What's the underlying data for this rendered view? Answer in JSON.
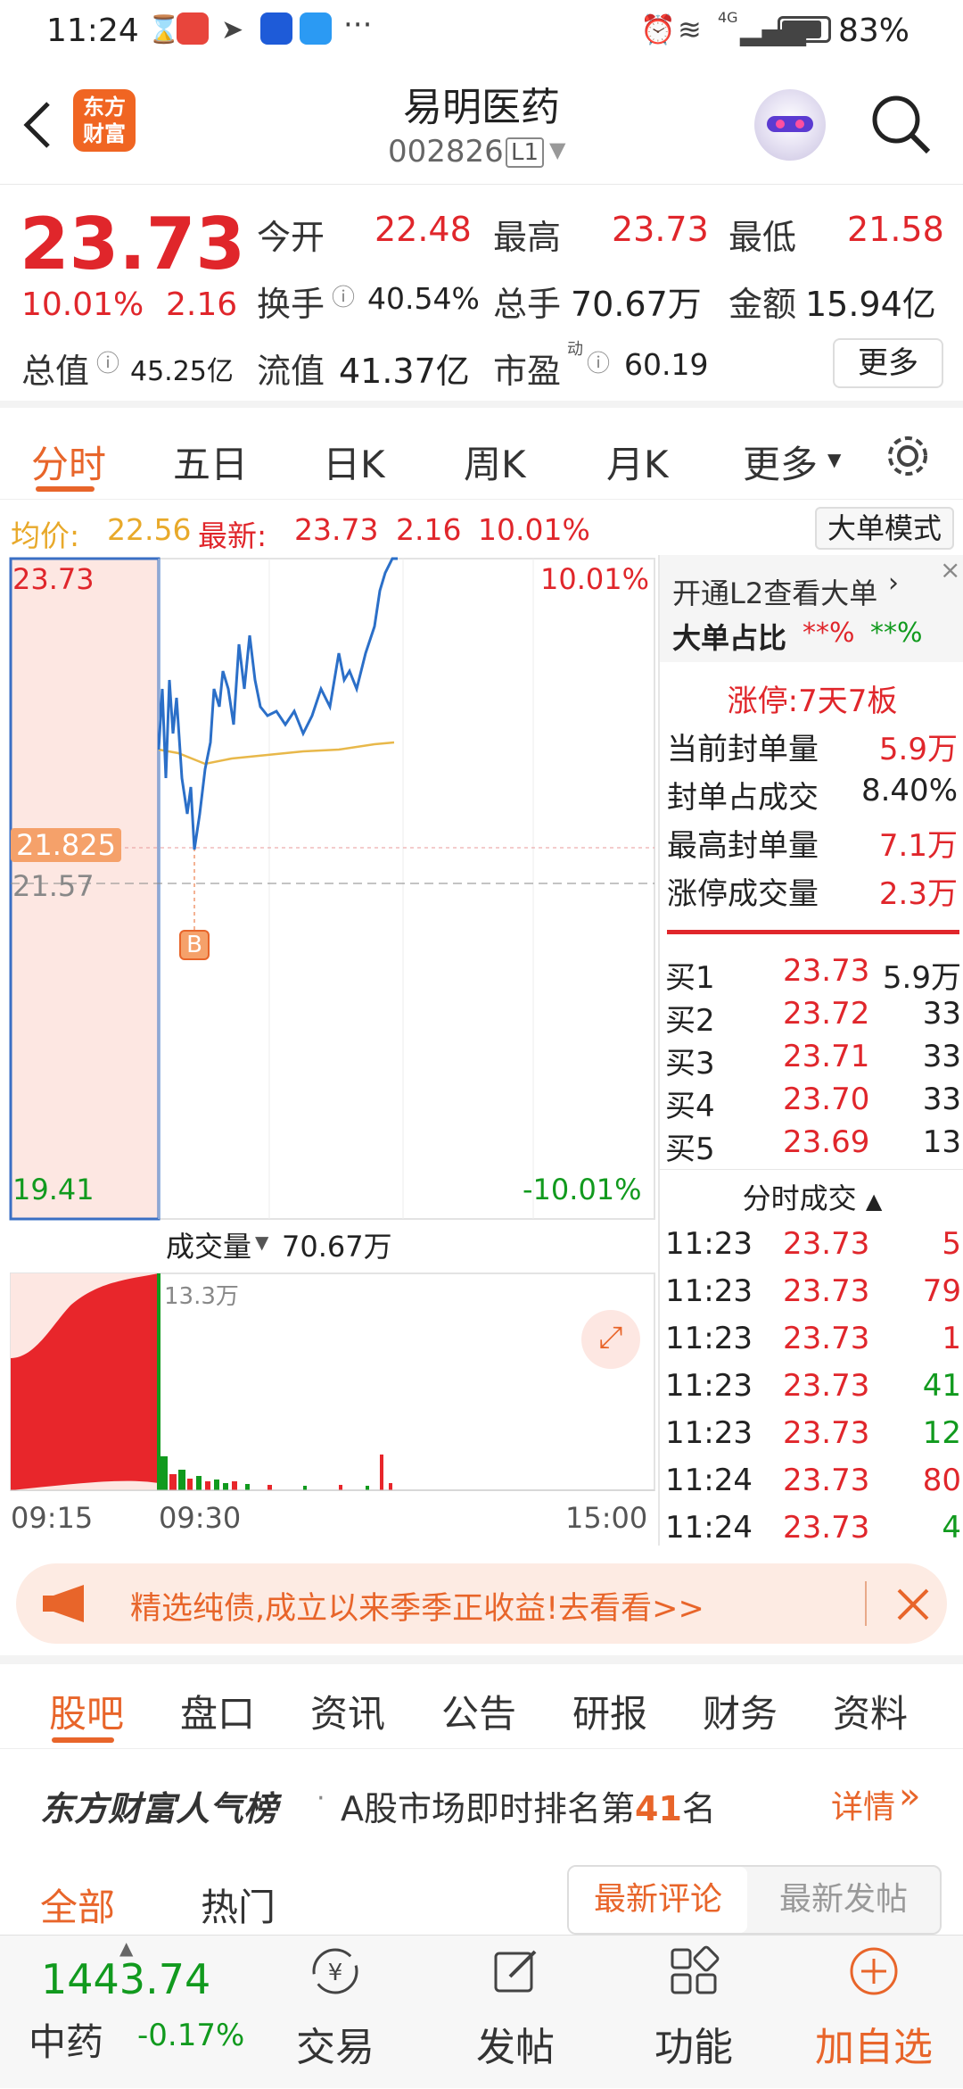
{
  "status": {
    "time": "11:24",
    "battery": "83%",
    "network": "4G"
  },
  "header": {
    "title": "易明医药",
    "code": "002826",
    "badge": "L1",
    "logo_text": "东方\n财富"
  },
  "quote": {
    "price": "23.73",
    "change_pct": "10.01%",
    "change_amt": "2.16",
    "open_label": "今开",
    "open": "22.48",
    "high_label": "最高",
    "high": "23.73",
    "low_label": "最低",
    "low": "21.58",
    "turnover_label": "换手",
    "turnover": "40.54%",
    "volume_label": "总手",
    "volume": "70.67万",
    "amount_label": "金额",
    "amount": "15.94亿",
    "mktcap_label": "总值",
    "mktcap": "45.25亿",
    "float_label": "流值",
    "float": "41.37亿",
    "pe_label": "市盈",
    "pe_sup": "动",
    "pe": "60.19",
    "more_label": "更多"
  },
  "tabs": [
    "分时",
    "五日",
    "日K",
    "周K",
    "月K",
    "更多"
  ],
  "pricebar": {
    "avg_label": "均价:",
    "avg": "22.56",
    "latest_label": "最新:",
    "latest": "23.73",
    "chg": "2.16",
    "pct": "10.01%",
    "mode_button": "大单模式"
  },
  "chart": {
    "top_price": "23.73",
    "top_pct": "10.01%",
    "mark_price": "21.825",
    "base_price": "21.57",
    "bottom_price": "19.41",
    "bottom_pct": "-10.01%",
    "b_marker": "B",
    "vol_label": "成交量",
    "vol_value": "70.67万",
    "vol_max": "13.3万",
    "time_start": "09:15",
    "time_mid": "09:30",
    "time_end": "15:00"
  },
  "side": {
    "l2_link": "开通L2查看大单",
    "big_ratio_label": "大单占比",
    "big_ratio_a": "**%",
    "big_ratio_b": "**%",
    "limit_up": "涨停:7天7板",
    "stats": [
      {
        "label": "当前封单量",
        "value": "5.9万",
        "red": true
      },
      {
        "label": "封单占成交",
        "value": "8.40%",
        "red": false
      },
      {
        "label": "最高封单量",
        "value": "7.1万",
        "red": true
      },
      {
        "label": "涨停成交量",
        "value": "2.3万",
        "red": true
      }
    ],
    "bids": [
      {
        "label": "买1",
        "price": "23.73",
        "vol": "5.9万"
      },
      {
        "label": "买2",
        "price": "23.72",
        "vol": "33"
      },
      {
        "label": "买3",
        "price": "23.71",
        "vol": "33"
      },
      {
        "label": "买4",
        "price": "23.70",
        "vol": "33"
      },
      {
        "label": "买5",
        "price": "23.69",
        "vol": "13"
      }
    ],
    "ticks_header": "分时成交",
    "ticks": [
      {
        "time": "11:23",
        "price": "23.73",
        "vol": "5",
        "color": "red"
      },
      {
        "time": "11:23",
        "price": "23.73",
        "vol": "79",
        "color": "red"
      },
      {
        "time": "11:23",
        "price": "23.73",
        "vol": "1",
        "color": "red"
      },
      {
        "time": "11:23",
        "price": "23.73",
        "vol": "41",
        "color": "green"
      },
      {
        "time": "11:23",
        "price": "23.73",
        "vol": "12",
        "color": "green"
      },
      {
        "time": "11:24",
        "price": "23.73",
        "vol": "80",
        "color": "red"
      },
      {
        "time": "11:24",
        "price": "23.73",
        "vol": "4",
        "color": "green"
      }
    ]
  },
  "ad": {
    "text": "精选纯债,成立以来季季正收益!去看看>>"
  },
  "bottom_tabs": [
    "股吧",
    "盘口",
    "资讯",
    "公告",
    "研报",
    "财务",
    "资料"
  ],
  "rank": {
    "title": "东方财富人气榜",
    "text_pre": "A股市场即时排名第",
    "rank": "41",
    "text_post": "名",
    "detail": "详情"
  },
  "filter": {
    "all": "全部",
    "hot": "热门",
    "latest_comment": "最新评论",
    "latest_post": "最新发帖"
  },
  "nav": {
    "index_value": "1443.74",
    "index_name": "中药",
    "index_pct": "-0.17%",
    "items": [
      "交易",
      "发帖",
      "功能",
      "加自选"
    ]
  }
}
